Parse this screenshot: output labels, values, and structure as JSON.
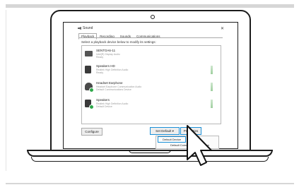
{
  "dialog": {
    "title": "Sound",
    "close_glyph": "✕",
    "tabs": [
      "Playback",
      "Recording",
      "Sounds",
      "Communications"
    ],
    "instruction": "Select a playback device below to modify its settings:",
    "devices": [
      {
        "name": "SENTOA6-11",
        "line1": "Intel(R) Display Audio",
        "line2": "Ready",
        "icon": "monitor-icon",
        "default": false
      },
      {
        "name": "Speakers HD",
        "line1": "Realtek High Definition Audio",
        "line2": "Ready",
        "icon": "speaker-icon",
        "default": false
      },
      {
        "name": "Headset Earphone",
        "line1": "Headset Earphone Communication Audio",
        "line2": "Default Communications Device",
        "icon": "headphones-icon",
        "default": true
      },
      {
        "name": "Speakers",
        "line1": "Realtek High Definition Audio",
        "line2": "Default Device",
        "icon": "speaker-icon",
        "default": true
      }
    ],
    "buttons": {
      "configure": "Configure",
      "set_default": "Set Default",
      "set_default_arrow": "▾",
      "properties": "Properties"
    },
    "menu": [
      "Default Device",
      "Default Communication Device"
    ]
  },
  "colors": {
    "highlight": "#1a8fd6",
    "status_green": "#2ea84a"
  }
}
